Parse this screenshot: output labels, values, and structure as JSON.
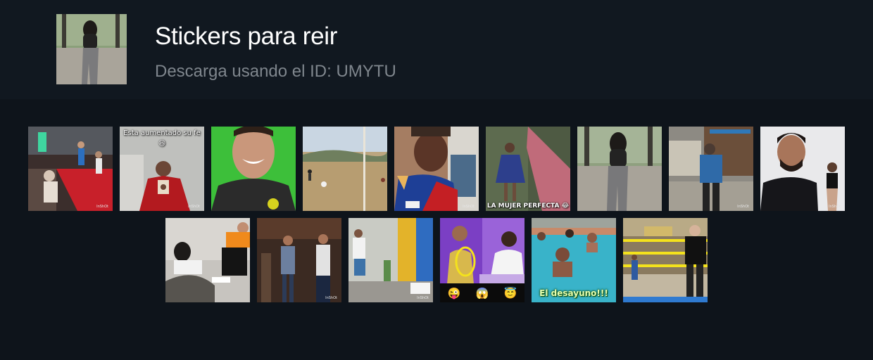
{
  "header": {
    "title": "Stickers para reir",
    "subtitle": "Descarga usando el ID: UMYTU",
    "thumbnail_icon": "woman-walking-photo"
  },
  "stickers_row1": [
    {
      "name": "runway-crowd",
      "caption": ""
    },
    {
      "name": "priest-praying",
      "caption": "Esta aumentado su fe 😆"
    },
    {
      "name": "smiling-man-green-screen",
      "caption": ""
    },
    {
      "name": "boy-soccer-field",
      "caption": ""
    },
    {
      "name": "man-eating-ice-cream",
      "caption": ""
    },
    {
      "name": "woman-on-bridge",
      "caption": "LA MUJER PERFECTA 😂"
    },
    {
      "name": "woman-walking",
      "caption": ""
    },
    {
      "name": "man-carrying-person",
      "caption": ""
    },
    {
      "name": "man-selfie",
      "caption": ""
    }
  ],
  "stickers_row2": [
    {
      "name": "kick-in-bed",
      "caption": ""
    },
    {
      "name": "dancing-men",
      "caption": ""
    },
    {
      "name": "man-falling-street",
      "caption": ""
    },
    {
      "name": "tv-presenters",
      "caption": "",
      "emojis": [
        "😜",
        "😱",
        "😇"
      ]
    },
    {
      "name": "pool-party",
      "caption": "El desayuno!!!"
    },
    {
      "name": "wrestling-ring",
      "caption": ""
    }
  ],
  "watermark": "InShOt",
  "colors": {
    "background": "#0e141b",
    "header_background": "#111820",
    "title": "#ffffff",
    "subtitle": "#7f868d"
  }
}
